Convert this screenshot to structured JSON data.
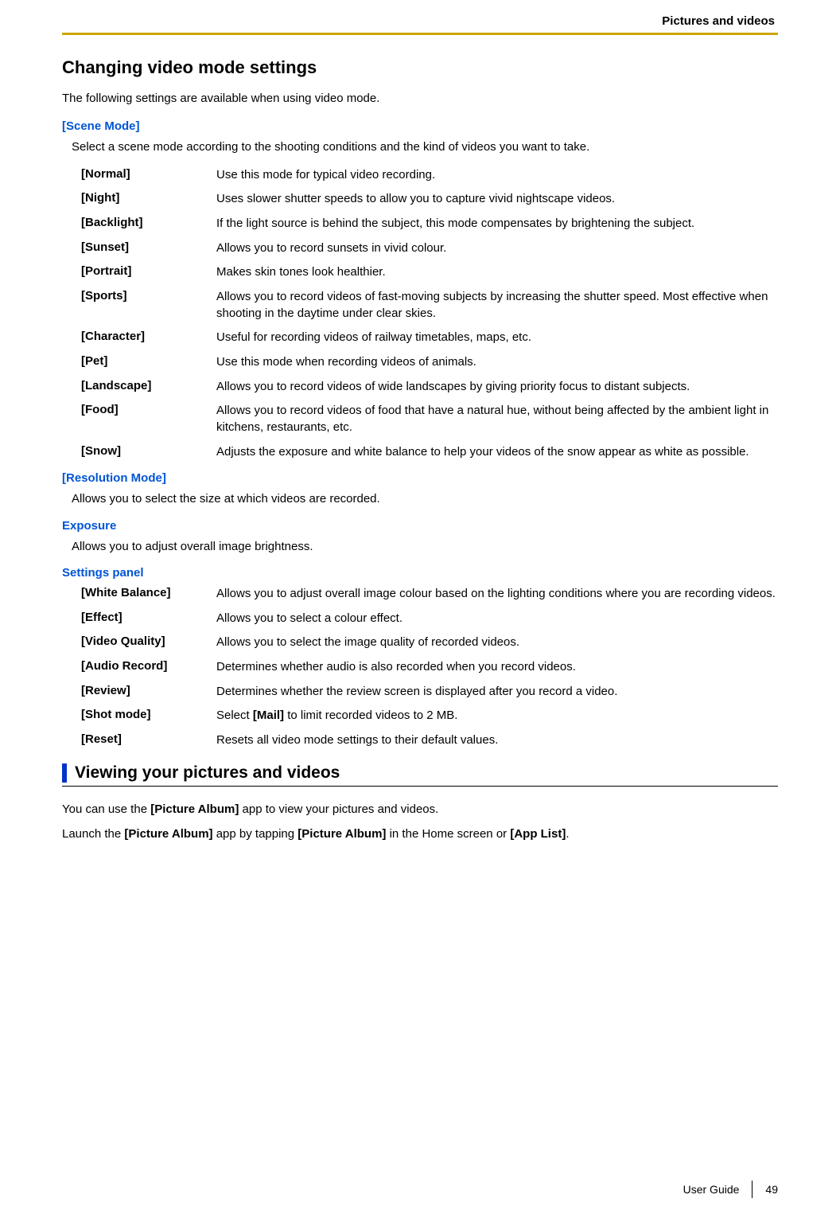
{
  "header": {
    "section_title": "Pictures and videos"
  },
  "h1": "Changing video mode settings",
  "intro": "The following settings are available when using video mode.",
  "scene_mode": {
    "heading": "[Scene Mode]",
    "desc": "Select a scene mode according to the shooting conditions and the kind of videos you want to take.",
    "items": [
      {
        "term": "[Normal]",
        "desc": "Use this mode for typical video recording."
      },
      {
        "term": "[Night]",
        "desc": "Uses slower shutter speeds to allow you to capture vivid nightscape videos."
      },
      {
        "term": "[Backlight]",
        "desc": "If the light source is behind the subject, this mode compensates by brightening the subject."
      },
      {
        "term": "[Sunset]",
        "desc": "Allows you to record sunsets in vivid colour."
      },
      {
        "term": "[Portrait]",
        "desc": "Makes skin tones look healthier."
      },
      {
        "term": "[Sports]",
        "desc": "Allows you to record videos of fast-moving subjects by increasing the shutter speed. Most effective when shooting in the daytime under clear skies."
      },
      {
        "term": "[Character]",
        "desc": "Useful for recording videos of railway timetables, maps, etc."
      },
      {
        "term": "[Pet]",
        "desc": "Use this mode when recording videos of animals."
      },
      {
        "term": "[Landscape]",
        "desc": "Allows you to record videos of wide landscapes by giving priority focus to distant subjects."
      },
      {
        "term": "[Food]",
        "desc": "Allows you to record videos of food that have a natural hue, without being affected by the ambient light in kitchens, restaurants, etc."
      },
      {
        "term": "[Snow]",
        "desc": "Adjusts the exposure and white balance to help your videos of the snow appear as white as possible."
      }
    ]
  },
  "resolution_mode": {
    "heading": "[Resolution Mode]",
    "desc": "Allows you to select the size at which videos are recorded."
  },
  "exposure": {
    "heading": "Exposure",
    "desc": "Allows you to adjust overall image brightness."
  },
  "settings_panel": {
    "heading": "Settings panel",
    "items": [
      {
        "term": "[White Balance]",
        "desc": "Allows you to adjust overall image colour based on the lighting conditions where you are recording videos."
      },
      {
        "term": "[Effect]",
        "desc": "Allows you to select a colour effect."
      },
      {
        "term": "[Video Quality]",
        "desc": "Allows you to select the image quality of recorded videos."
      },
      {
        "term": "[Audio Record]",
        "desc": "Determines whether audio is also recorded when you record videos."
      },
      {
        "term": "[Review]",
        "desc": "Determines whether the review screen is displayed after you record a video."
      },
      {
        "term": "[Shot mode]",
        "desc_pre": "Select ",
        "bold": "[Mail]",
        "desc_post": " to limit recorded videos to 2 MB."
      },
      {
        "term": "[Reset]",
        "desc": "Resets all video mode settings to their default values."
      }
    ]
  },
  "section2": {
    "heading": "Viewing your pictures and videos",
    "p1_pre": "You can use the ",
    "p1_b1": "[Picture Album]",
    "p1_post": " app to view your pictures and videos.",
    "p2_pre": "Launch the ",
    "p2_b1": "[Picture Album]",
    "p2_mid1": " app by tapping ",
    "p2_b2": "[Picture Album]",
    "p2_mid2": " in the Home screen or ",
    "p2_b3": "[App List]",
    "p2_post": "."
  },
  "footer": {
    "label": "User Guide",
    "page": "49"
  }
}
